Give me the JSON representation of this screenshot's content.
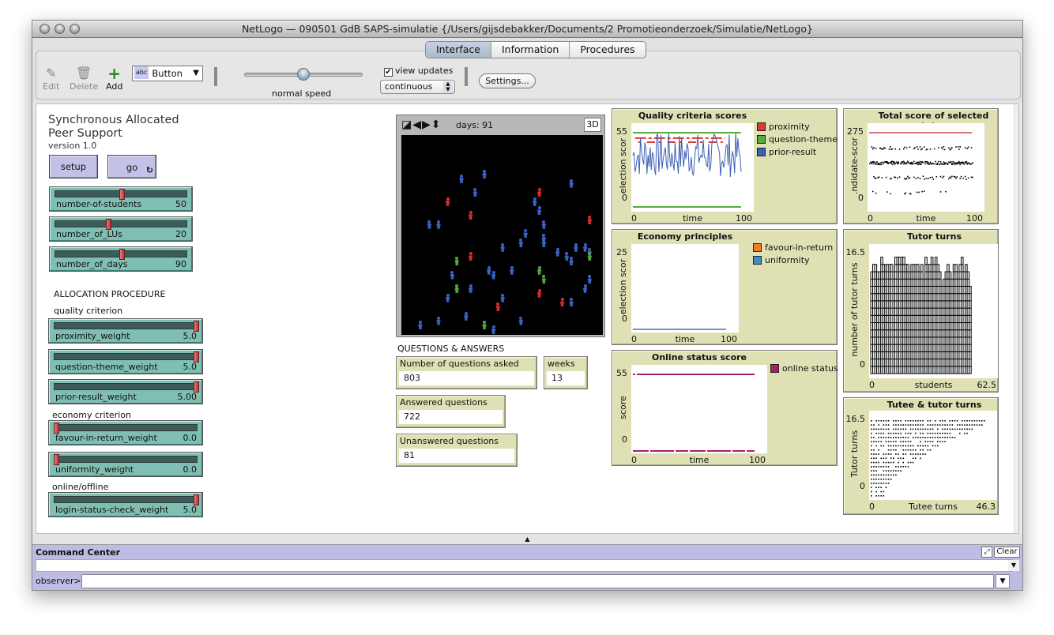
{
  "window": {
    "title": "NetLogo — 090501 GdB SAPS-simulatie {/Users/gijsdebakker/Documents/2 Promotieonderzoek/Simulatie/NetLogo}"
  },
  "tabs": [
    {
      "label": "Interface",
      "active": true
    },
    {
      "label": "Information",
      "active": false
    },
    {
      "label": "Procedures",
      "active": false
    }
  ],
  "toolbar": {
    "edit_label": "Edit",
    "delete_label": "Delete",
    "add_label": "Add",
    "widget_type": "Button",
    "widget_type_icon": "abc",
    "speed_label": "normal speed",
    "speed_fraction": 0.5,
    "view_updates_label": "view updates",
    "view_updates_checked": true,
    "update_mode": "continuous",
    "settings_label": "Settings..."
  },
  "model": {
    "title_line1": "Synchronous Allocated",
    "title_line2": "Peer Support",
    "version": "version 1.0"
  },
  "buttons": {
    "setup": "setup",
    "go": "go",
    "go_forever_icon": "↻"
  },
  "sliders_top": [
    {
      "label": "number-of-students",
      "value": "50",
      "fraction": 0.5
    },
    {
      "label": "number_of_LUs",
      "value": "20",
      "fraction": 0.4
    },
    {
      "label": "number_of_days",
      "value": "90",
      "fraction": 0.5
    }
  ],
  "allocation": {
    "heading": "ALLOCATION PROCEDURE",
    "quality_label": "quality criterion",
    "economy_label": "economy criterion",
    "online_label": "online/offline",
    "quality_sliders": [
      {
        "label": "proximity_weight",
        "value": "5.0",
        "fraction": 1.0
      },
      {
        "label": "question-theme_weight",
        "value": "5.0",
        "fraction": 1.0
      },
      {
        "label": "prior-result_weight",
        "value": "5.00",
        "fraction": 1.0
      }
    ],
    "economy_sliders": [
      {
        "label": "favour-in-return_weight",
        "value": "0.0",
        "fraction": 0.0
      },
      {
        "label": "uniformity_weight",
        "value": "0.0",
        "fraction": 0.0
      }
    ],
    "online_sliders": [
      {
        "label": "login-status-check_weight",
        "value": "5.0",
        "fraction": 1.0
      }
    ]
  },
  "view": {
    "tick_label": "days: 91",
    "btn_3d": "3D",
    "colors": {
      "blue": "#3a62c2",
      "red": "#d92b2b",
      "green": "#4fa83a"
    },
    "agents": [
      [
        "blue",
        63,
        43
      ],
      [
        "blue",
        88,
        38
      ],
      [
        "blue",
        78,
        58
      ],
      [
        "red",
        48,
        68
      ],
      [
        "red",
        73,
        83
      ],
      [
        "blue",
        28,
        93
      ],
      [
        "blue",
        38,
        93
      ],
      [
        "red",
        148,
        58
      ],
      [
        "blue",
        183,
        48
      ],
      [
        "blue",
        143,
        68
      ],
      [
        "blue",
        148,
        78
      ],
      [
        "red",
        203,
        88
      ],
      [
        "blue",
        153,
        93
      ],
      [
        "blue",
        133,
        103
      ],
      [
        "blue",
        128,
        113
      ],
      [
        "blue",
        153,
        108
      ],
      [
        "blue",
        153,
        113
      ],
      [
        "blue",
        108,
        118
      ],
      [
        "blue",
        168,
        123
      ],
      [
        "blue",
        188,
        118
      ],
      [
        "blue",
        198,
        118
      ],
      [
        "blue",
        203,
        123
      ],
      [
        "green",
        203,
        128
      ],
      [
        "blue",
        178,
        128
      ],
      [
        "blue",
        183,
        133
      ],
      [
        "green",
        58,
        133
      ],
      [
        "red",
        73,
        128
      ],
      [
        "blue",
        53,
        148
      ],
      [
        "blue",
        93,
        143
      ],
      [
        "blue",
        98,
        148
      ],
      [
        "blue",
        118,
        143
      ],
      [
        "green",
        148,
        143
      ],
      [
        "green",
        153,
        153
      ],
      [
        "green",
        58,
        163
      ],
      [
        "blue",
        73,
        163
      ],
      [
        "blue",
        203,
        153
      ],
      [
        "blue",
        198,
        163
      ],
      [
        "blue",
        48,
        173
      ],
      [
        "blue",
        108,
        173
      ],
      [
        "red",
        148,
        168
      ],
      [
        "red",
        173,
        178
      ],
      [
        "blue",
        183,
        178
      ],
      [
        "red",
        103,
        183
      ],
      [
        "blue",
        68,
        193
      ],
      [
        "blue",
        38,
        198
      ],
      [
        "blue",
        18,
        203
      ],
      [
        "blue",
        128,
        198
      ],
      [
        "green",
        88,
        203
      ],
      [
        "blue",
        98,
        208
      ]
    ]
  },
  "qa": {
    "heading": "QUESTIONS & ANSWERS",
    "asked_label": "Number of questions asked",
    "asked_value": "803",
    "weeks_label": "weeks",
    "weeks_value": "13",
    "answered_label": "Answered questions",
    "answered_value": "722",
    "unanswered_label": "Unanswered questions",
    "unanswered_value": "81"
  },
  "command_center": {
    "title": "Command Center",
    "clear_label": "Clear",
    "prompt": "observer>",
    "input_value": ""
  },
  "chart_data": [
    {
      "id": "quality",
      "type": "line",
      "title": "Quality criteria scores",
      "xlabel": "time",
      "ylabel": "election scor",
      "xlim": [
        0,
        100
      ],
      "ylim": [
        0,
        55
      ],
      "x_ticks": [
        "0",
        "100"
      ],
      "y_ticks": [
        "0",
        "55"
      ],
      "legend_position": "right",
      "series": [
        {
          "name": "proximity",
          "color": "#d93a32",
          "style": "dashed-near-top",
          "level": 51
        },
        {
          "name": "question-theme",
          "color": "#5aaa3c",
          "level": 55
        },
        {
          "name": "prior-result",
          "color": "#3d5fb5",
          "range": [
            22,
            55
          ],
          "mean": 40
        }
      ]
    },
    {
      "id": "economy",
      "type": "line",
      "title": "Economy principles scores",
      "xlabel": "time",
      "ylabel": "election scor",
      "xlim": [
        0,
        100
      ],
      "ylim": [
        0,
        25
      ],
      "x_ticks": [
        "0",
        "100"
      ],
      "y_ticks": [
        "0",
        "25"
      ],
      "legend_position": "right",
      "series": [
        {
          "name": "favour-in-return",
          "color": "#f07a2a",
          "level": 0
        },
        {
          "name": "uniformity",
          "color": "#3a8fc8",
          "level": 0
        }
      ]
    },
    {
      "id": "online",
      "type": "line",
      "title": "Online status score",
      "xlabel": "time",
      "ylabel": "score",
      "xlim": [
        0,
        100
      ],
      "ylim": [
        0,
        55
      ],
      "x_ticks": [
        "0",
        "100"
      ],
      "y_ticks": [
        "0",
        "55"
      ],
      "legend_position": "right",
      "series": [
        {
          "name": "online status",
          "color": "#a8206a",
          "levels": [
            0,
            55
          ]
        }
      ]
    },
    {
      "id": "total",
      "type": "scatter",
      "title": "Total score of selected tutor",
      "xlabel": "time",
      "ylabel": ".ndidate-scor",
      "xlim": [
        0,
        100
      ],
      "ylim": [
        0,
        275
      ],
      "x_ticks": [
        "0",
        "100"
      ],
      "y_ticks": [
        "0",
        "275"
      ],
      "reference_line": {
        "value": 275,
        "color": "#c02020"
      },
      "bands": [
        220,
        165,
        110,
        55
      ]
    },
    {
      "id": "tutor_turns",
      "type": "bar",
      "title": "Tutor turns",
      "xlabel": "students",
      "ylabel": "number of tutor turns",
      "xlim": [
        0,
        62.5
      ],
      "ylim": [
        0,
        16.5
      ],
      "x_ticks": [
        "0",
        "62.5"
      ],
      "y_ticks": [
        "0",
        "16.5"
      ],
      "values": [
        14,
        15,
        15,
        14,
        14,
        16,
        15,
        15,
        15,
        15,
        15,
        14,
        16,
        16,
        16,
        16,
        16,
        15,
        15,
        14,
        15,
        15,
        15,
        15,
        14,
        15,
        13,
        16,
        15,
        15,
        16,
        15,
        16,
        15,
        14,
        12,
        13,
        14,
        15,
        14,
        13,
        15,
        15,
        14,
        15,
        16,
        14,
        15,
        14,
        12
      ]
    },
    {
      "id": "tutee_tutor",
      "type": "scatter",
      "title": "Tutee & tutor turns",
      "xlabel": "Tutee turns",
      "ylabel": "Tutor turns",
      "xlim": [
        0,
        46.3
      ],
      "ylim": [
        0,
        16.5
      ],
      "x_ticks": [
        "0",
        "46.3"
      ],
      "y_ticks": [
        "0",
        "16.5"
      ],
      "rows": [
        {
          "y": 18,
          "x_max": 46
        },
        {
          "y": 17,
          "x_max": 45
        },
        {
          "y": 16,
          "x_max": 41
        },
        {
          "y": 15,
          "x_max": 39
        },
        {
          "y": 14,
          "x_max": 34
        },
        {
          "y": 13,
          "x_max": 30
        },
        {
          "y": 12,
          "x_max": 28
        },
        {
          "y": 11,
          "x_max": 24
        },
        {
          "y": 10,
          "x_max": 22
        },
        {
          "y": 9,
          "x_max": 20
        },
        {
          "y": 8,
          "x_max": 17
        },
        {
          "y": 7,
          "x_max": 15
        },
        {
          "y": 6,
          "x_max": 12
        },
        {
          "y": 5,
          "x_max": 10
        },
        {
          "y": 4,
          "x_max": 8
        },
        {
          "y": 3,
          "x_max": 7
        },
        {
          "y": 2,
          "x_max": 6
        },
        {
          "y": 1,
          "x_max": 6
        },
        {
          "y": 0,
          "x_max": 5
        }
      ]
    }
  ]
}
